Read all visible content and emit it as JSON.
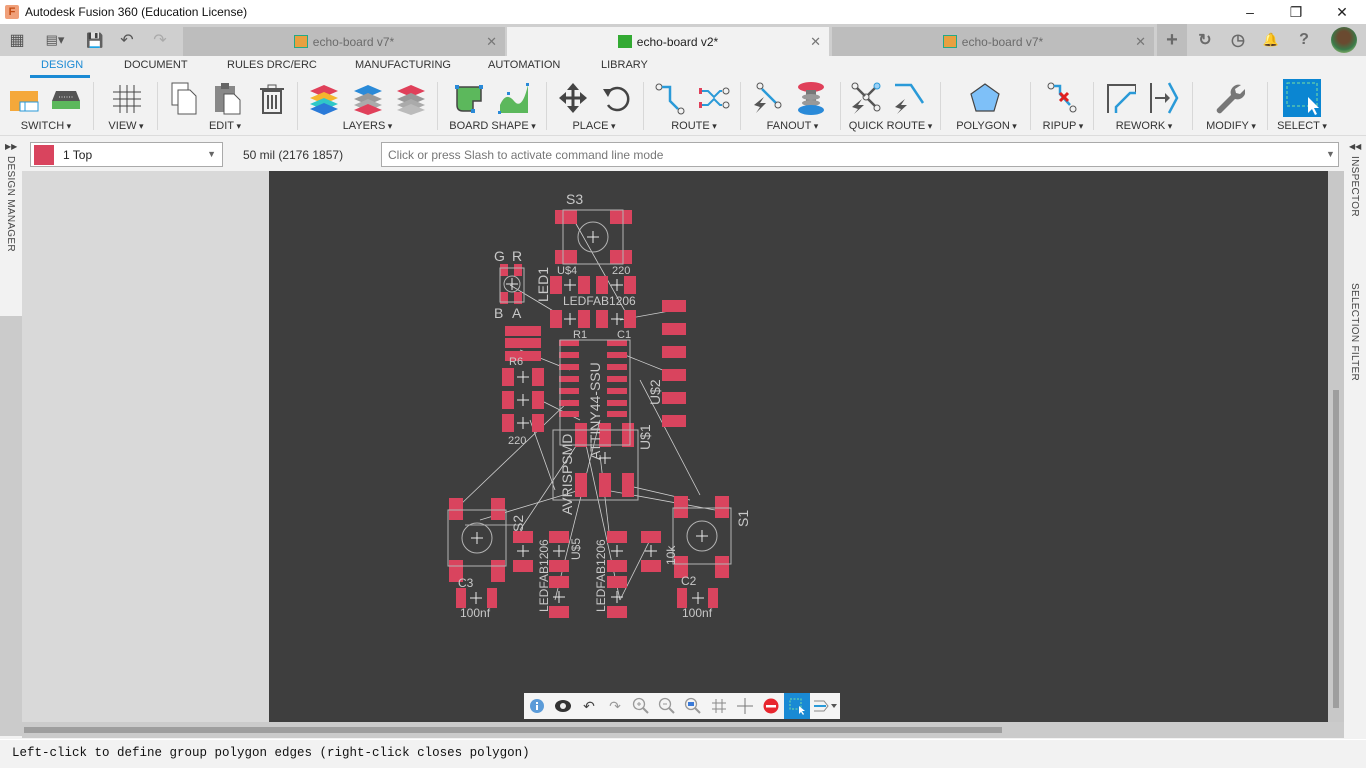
{
  "app": {
    "title": "Autodesk Fusion 360 (Education License)",
    "logo_letter": "F"
  },
  "window_controls": {
    "minimize": "–",
    "restore": "❐",
    "close": "✕"
  },
  "quick_access": {
    "apps_icon": "▦",
    "file_icon": "▤▾",
    "save_icon": "💾",
    "undo_icon": "↶",
    "redo_icon": "↷"
  },
  "doc_tabs": [
    {
      "label": "echo-board v7*",
      "active": false,
      "close": "✕"
    },
    {
      "label": "echo-board v2*",
      "active": true,
      "close": "✕"
    },
    {
      "label": "echo-board v7*",
      "active": false,
      "close": "✕"
    }
  ],
  "top_icons": {
    "new_tab": "+",
    "job_status": "↻",
    "clock": "◷",
    "notifications": "🔔",
    "help": "?"
  },
  "ribbon_tabs": [
    "DESIGN",
    "DOCUMENT",
    "RULES DRC/ERC",
    "MANUFACTURING",
    "AUTOMATION",
    "LIBRARY"
  ],
  "ribbon_groups": [
    "SWITCH",
    "VIEW",
    "EDIT",
    "LAYERS",
    "BOARD SHAPE",
    "PLACE",
    "ROUTE",
    "FANOUT",
    "QUICK ROUTE",
    "POLYGON",
    "RIPUP",
    "REWORK",
    "MODIFY",
    "SELECT"
  ],
  "command_bar": {
    "layer": "1 Top",
    "layer_color": "#d9445e",
    "grid_coord": "50 mil (2176 1857)",
    "command_placeholder": "Click or press Slash to activate command line mode"
  },
  "side_panels": {
    "left": "DESIGN MANAGER",
    "right_top": "INSPECTOR",
    "right_bottom": "SELECTION FILTER"
  },
  "board": {
    "pad_color": "#d9445e",
    "silk_color": "#b4b4b4",
    "labels": [
      "S3",
      "G",
      "R",
      "B",
      "A",
      "LED1",
      "U$4",
      "220",
      "10k",
      "LEDFAB1206",
      "100nF",
      "R1",
      "C1",
      "R6",
      "220",
      "220",
      "220",
      "U$2",
      "ATTINY44-SSU",
      "AVRISPSMD",
      "U$1",
      "S2",
      "S1",
      "C3",
      "C2",
      "100nf",
      "100nf",
      "U$5",
      "U$3",
      "LEDFAB1206",
      "LEDFAB1206",
      "220",
      "220",
      "10k"
    ]
  },
  "nav_toolbar": [
    "info",
    "eye",
    "undo",
    "redo",
    "zoom-in",
    "zoom-out",
    "zoom-fit",
    "grid",
    "crosshair",
    "stop",
    "select-window",
    "wire-bend"
  ],
  "status": {
    "message": "Left-click to define group polygon edges (right-click closes polygon)"
  }
}
